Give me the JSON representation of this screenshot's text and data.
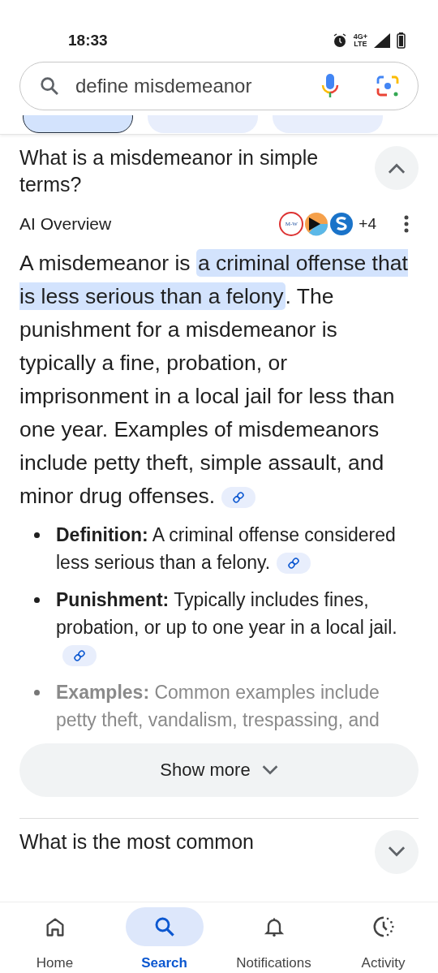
{
  "status_bar": {
    "time": "18:33",
    "network": "4G+",
    "network_sub": "LTE"
  },
  "search": {
    "value": "define misdemeanor"
  },
  "chips": [
    {
      "selected": true
    },
    {
      "selected": false
    },
    {
      "selected": false
    }
  ],
  "questions": [
    {
      "title": "What is a misdemeanor in simple terms?",
      "expanded": true,
      "overview": {
        "label": "AI Overview",
        "source_logo_text": "M-W",
        "more_sources": "+4",
        "summary": [
          {
            "text": "A misdemeanor is ",
            "highlighted": false
          },
          {
            "text": "a criminal offense that is less serious than a felony",
            "highlighted": true
          },
          {
            "text": ". The punishment for a misdemeanor is typically a fine, probation, or imprisonment in a local jail for less than one year. Examples of misdemeanors include petty theft, simple assault, and minor drug offenses.",
            "highlighted": false
          }
        ],
        "bullets": [
          {
            "text": "**Definition:** A criminal offense considered less serious than a felony.",
            "faded": false,
            "has_link": true
          },
          {
            "text": "**Punishment:** Typically includes fines, probation, or up to one year in a local jail.",
            "faded": false,
            "has_link": true
          },
          {
            "text": "**Examples:** Common examples include petty theft, vandalism, trespassing, and",
            "faded": true,
            "has_link": false
          }
        ],
        "show_more": "Show more"
      }
    },
    {
      "title": "What is the most common",
      "expanded": false
    }
  ],
  "nav": [
    {
      "label": "Home",
      "kind": "home",
      "selected": false
    },
    {
      "label": "Search",
      "kind": "search",
      "selected": true
    },
    {
      "label": "Notifications",
      "kind": "bell",
      "selected": false
    },
    {
      "label": "Activity",
      "kind": "activity",
      "selected": false
    }
  ]
}
